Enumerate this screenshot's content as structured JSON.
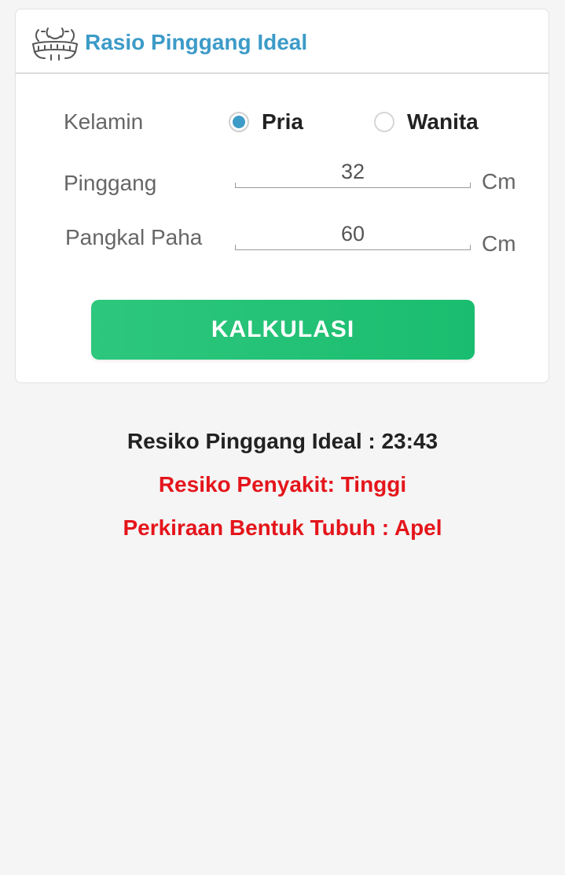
{
  "header": {
    "title": "Rasio Pinggang Ideal",
    "icon": "waist-measure-icon",
    "accent_color": "#3d9bc8"
  },
  "form": {
    "gender_label": "Kelamin",
    "options": [
      {
        "label": "Pria",
        "checked": true
      },
      {
        "label": "Wanita",
        "checked": false
      }
    ],
    "waist_label": "Pinggang",
    "waist_value": "32",
    "waist_unit": "Cm",
    "thigh_label": "Pangkal Paha",
    "thigh_value": "60",
    "thigh_unit": "Cm",
    "button_label": "KALKULASI",
    "button_color": "#1fbf73"
  },
  "results": {
    "ratio": "Resiko Pinggang Ideal : 23:43",
    "risk": "Resiko Penyakit: Tinggi",
    "body_shape": "Perkiraan Bentuk Tubuh : Apel",
    "ratio_color": "#222222",
    "warning_color": "#e4151b"
  }
}
